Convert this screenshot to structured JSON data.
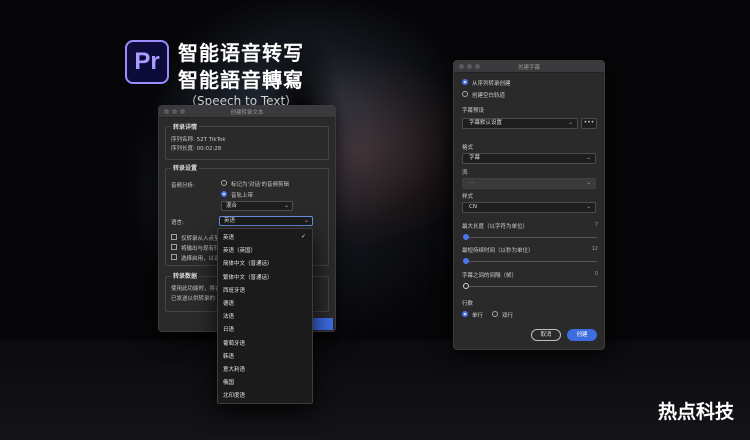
{
  "heading": {
    "logo_text": "Pr",
    "title_simplified": "智能语音转写",
    "title_traditional": "智能語音轉寫",
    "subtitle": "（Speech to Text）"
  },
  "brand_text": "热点科技",
  "transcribe_dialog": {
    "title": "创建转录文本",
    "details_section": {
      "label": "转录详情",
      "sequence_name": "序列名称: 52T TikTok",
      "sequence_length": "序列长度: 00:02:28"
    },
    "settings_section": {
      "label": "转录设置",
      "audio_analysis_label": "音频分析:",
      "option_marked": "标记为'对话'的音频剪辑",
      "option_track": "音轨上带",
      "mix_value": "混合",
      "language_label": "语言:",
      "language_value": "英语",
      "checkbox_1": "仅转录从入点至",
      "checkbox_2": "将输出与现有转",
      "checkbox_3": "选择启用，以识"
    },
    "data_section": {
      "label": "转录数据",
      "text_line_1": "使用此功能时，将会",
      "text_line_2": "已发送以供转录的"
    }
  },
  "language_dropdown": {
    "items": [
      "英语",
      "英语（英国）",
      "简体中文（普通话）",
      "繁体中文（普通话）",
      "西班牙语",
      "德语",
      "法语",
      "日语",
      "葡萄牙语",
      "韩语",
      "意大利语",
      "俄国",
      "北印度语"
    ],
    "selected_index": 0,
    "check_mark": "✓"
  },
  "caption_dialog": {
    "title": "创建字幕",
    "option_from_transcript": "从序列转录创建",
    "option_blank_track": "创建空白轨道",
    "preset_label": "字幕预设",
    "preset_value": "字幕默认设置",
    "more_label": "•••",
    "format_label": "格式",
    "format_value": "字幕",
    "stream_label": "流",
    "stream_value": "—",
    "style_label": "样式",
    "style_value": "CN",
    "max_length_label": "最大长度（以字符为单位）",
    "max_length_value": "7",
    "min_duration_label": "最短持续时间（以秒为单位）",
    "min_duration_value": "12",
    "gap_label": "字幕之间的间隔（帧）",
    "gap_value": "0",
    "lines_label": "行数",
    "single_line": "单行",
    "double_line": "双行",
    "cancel_label": "取消",
    "create_label": "创建"
  }
}
